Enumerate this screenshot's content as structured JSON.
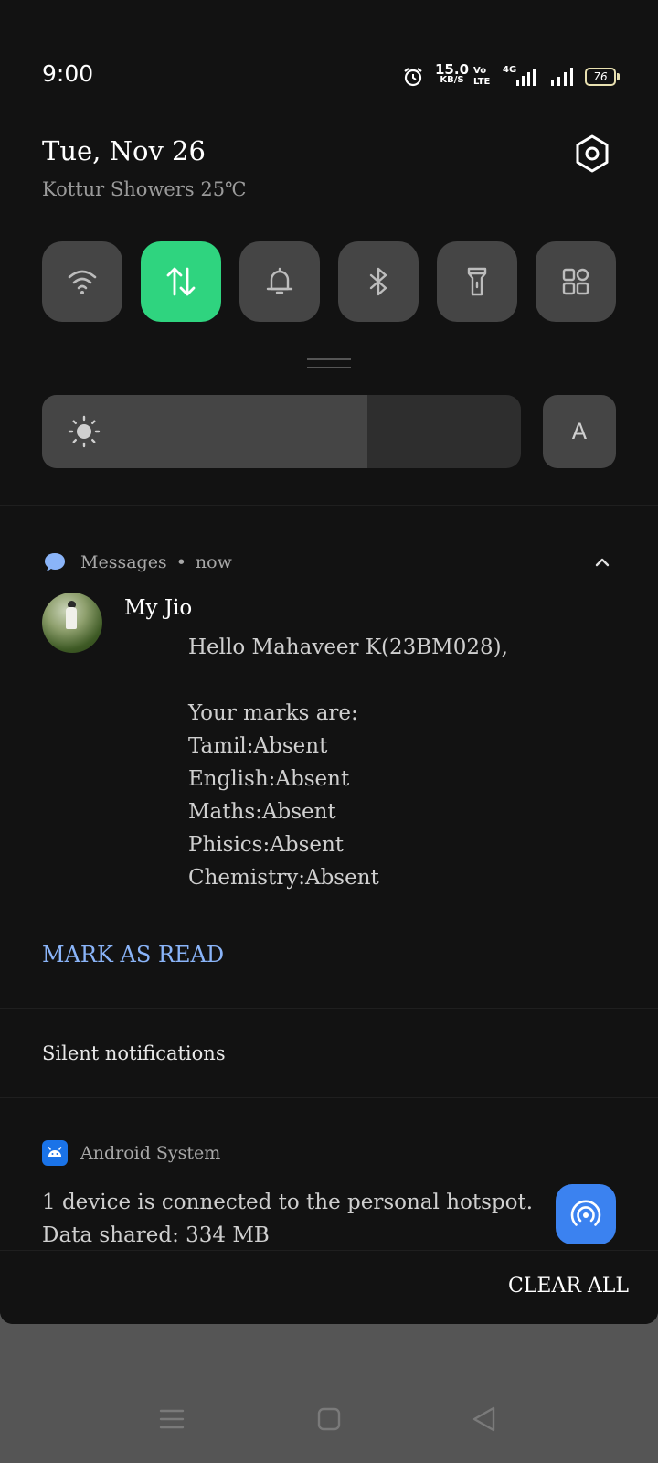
{
  "status_bar": {
    "time": "9:00",
    "speed_value": "15.0",
    "speed_unit": "KB/S",
    "volte_top": "Vo",
    "volte_bottom": "LTE",
    "network": "4G",
    "battery": "76",
    "icons": [
      "alarm-icon",
      "signal-icon",
      "signal-icon-2",
      "battery-icon"
    ]
  },
  "header": {
    "date": "Tue, Nov 26",
    "weather": "Kottur Showers 25℃",
    "settings_icon": "gear-icon"
  },
  "quick_tiles": [
    {
      "name": "wifi",
      "icon": "wifi-icon",
      "active": false
    },
    {
      "name": "mobile-data",
      "icon": "data-arrows-icon",
      "active": true
    },
    {
      "name": "sound",
      "icon": "bell-icon",
      "active": false
    },
    {
      "name": "bluetooth",
      "icon": "bluetooth-icon",
      "active": false
    },
    {
      "name": "flashlight",
      "icon": "flashlight-icon",
      "active": false
    },
    {
      "name": "more",
      "icon": "grid-icon",
      "active": false
    }
  ],
  "brightness": {
    "level": 0.68,
    "auto_label": "A"
  },
  "messages_notification": {
    "app": "Messages",
    "time": "now",
    "sender": "My Jio",
    "body": "Hello Mahaveer K(23BM028),\n\nYour marks are:\nTamil:Absent\nEnglish:Absent\nMaths:Absent\nPhisics:Absent\nChemistry:Absent",
    "action": "MARK AS READ"
  },
  "silent_header": "Silent notifications",
  "system_notification": {
    "app": "Android System",
    "line1": "1 device is connected to the personal hotspot.",
    "line2": "Data shared: 334 MB"
  },
  "clear_all": "CLEAR ALL",
  "colors": {
    "active_tile": "#2fd47f",
    "link": "#8ab4f8",
    "hotspot": "#3b82f0"
  }
}
